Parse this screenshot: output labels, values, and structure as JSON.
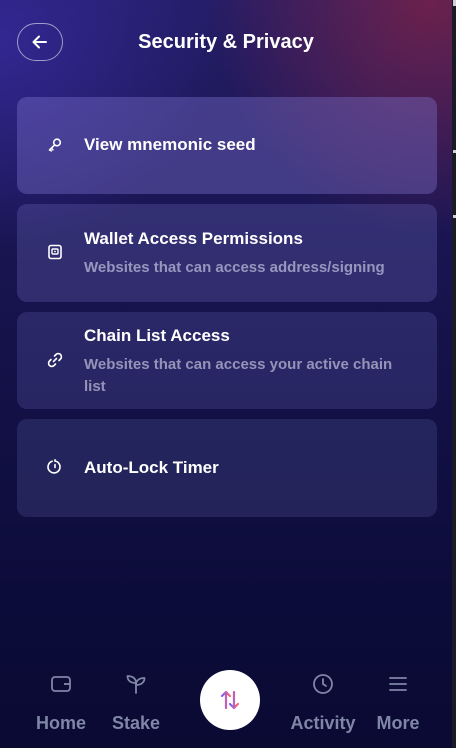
{
  "header": {
    "title": "Security & Privacy",
    "back_icon": "arrow-left-icon"
  },
  "settings": [
    {
      "title": "View mnemonic seed",
      "description": "",
      "icon": "key-icon"
    },
    {
      "title": "Wallet Access Permissions",
      "description": "Websites that can access address/signing",
      "icon": "wallet-icon"
    },
    {
      "title": "Chain List Access",
      "description": "Websites that can access your active chain list",
      "icon": "link-icon"
    },
    {
      "title": "Auto-Lock Timer",
      "description": "",
      "icon": "timer-icon"
    }
  ],
  "nav": {
    "items": [
      {
        "label": "Home",
        "icon": "wallet-icon"
      },
      {
        "label": "Stake",
        "icon": "sprout-icon"
      },
      {
        "label": "Activity",
        "icon": "clock-icon"
      },
      {
        "label": "More",
        "icon": "menu-icon"
      }
    ],
    "swap_icon": "swap-arrows-icon"
  },
  "colors": {
    "accent_gradient_start": "#7b5cff",
    "accent_gradient_end": "#ff6b6b",
    "nav_label": "#7f86a6",
    "background_dark": "#0a0a33"
  }
}
